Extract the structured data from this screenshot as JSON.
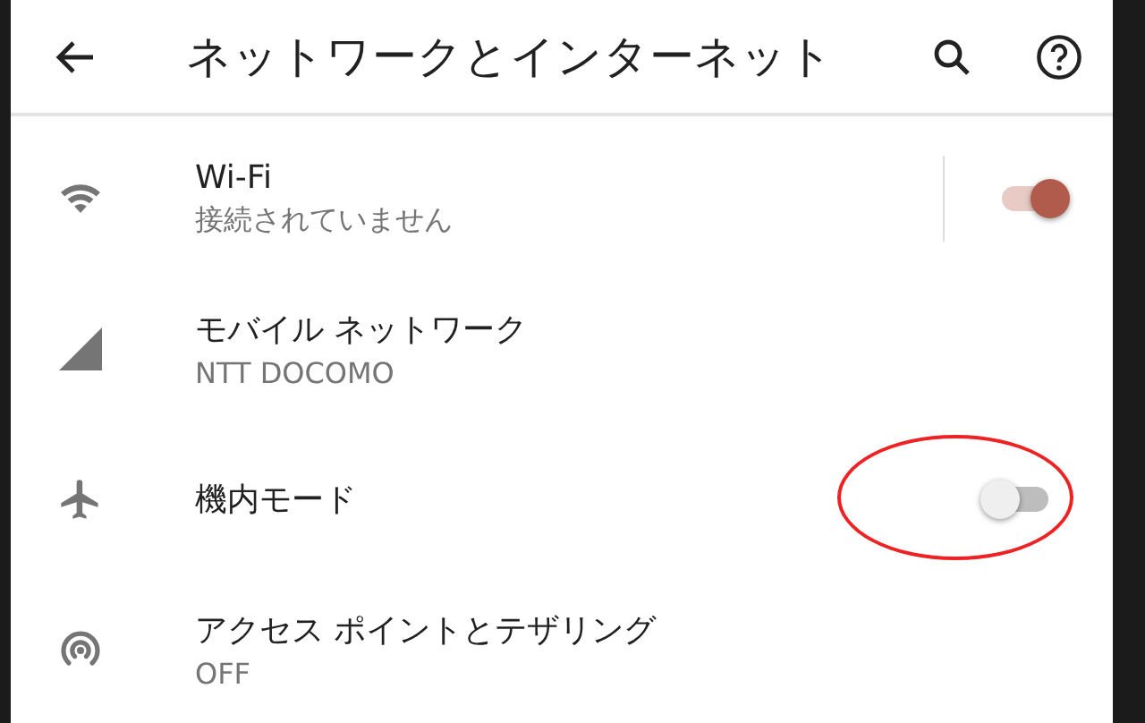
{
  "app_bar": {
    "title": "ネットワークとインターネット"
  },
  "items": [
    {
      "title": "Wi-Fi",
      "summary": "接続されていません",
      "kind": "split_switch",
      "on": true
    },
    {
      "title": "モバイル ネットワーク",
      "summary": "NTT DOCOMO",
      "kind": "plain"
    },
    {
      "title": "機内モード",
      "kind": "switch",
      "on": false,
      "highlighted": true
    },
    {
      "title": "アクセス ポイントとテザリング",
      "summary": "OFF",
      "kind": "plain"
    }
  ]
}
